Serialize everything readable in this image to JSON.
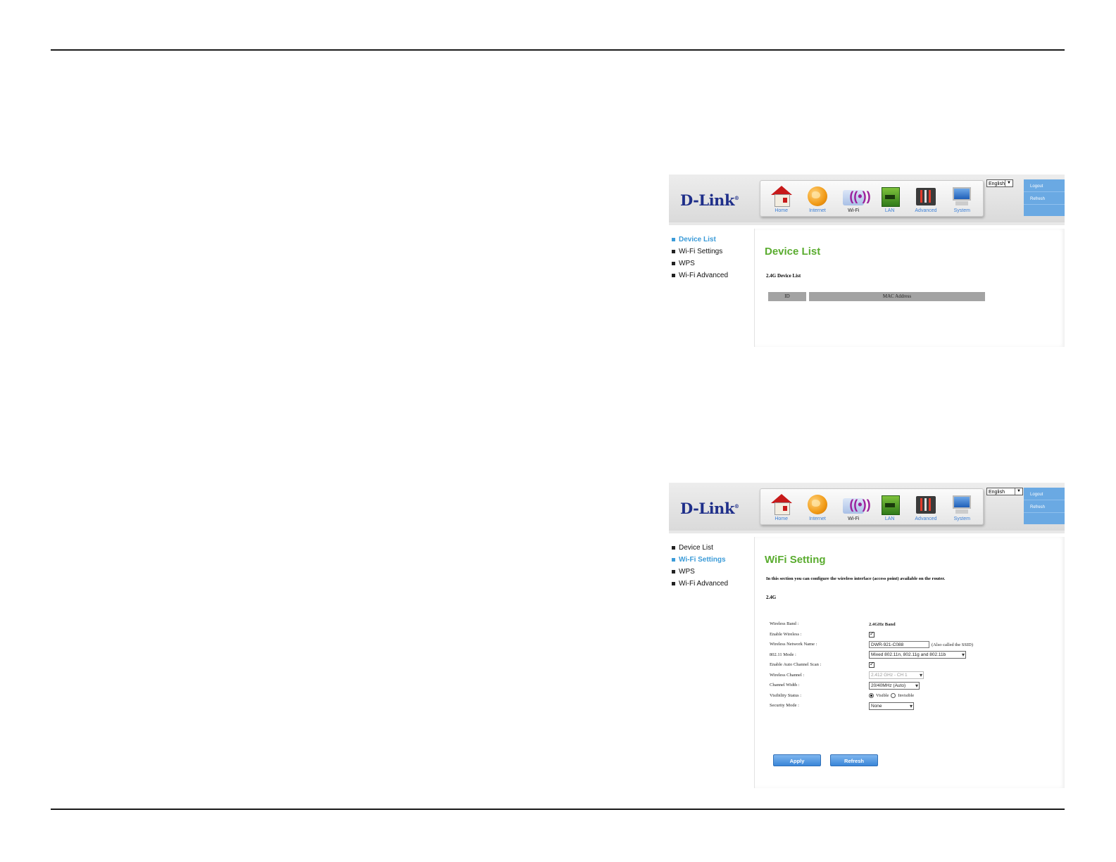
{
  "brand": "D-Link",
  "nav": {
    "items": [
      {
        "label": "Home",
        "icon": "home-icon"
      },
      {
        "label": "Internet",
        "icon": "globe-icon"
      },
      {
        "label": "Wi-Fi",
        "icon": "wifi-icon"
      },
      {
        "label": "LAN",
        "icon": "lan-icon"
      },
      {
        "label": "Advanced",
        "icon": "tools-icon"
      },
      {
        "label": "System",
        "icon": "monitor-icon"
      }
    ]
  },
  "language": "English",
  "side_buttons": {
    "logout": "Logout",
    "refresh": "Refresh"
  },
  "leftnav": [
    "Device List",
    "Wi-Fi Settings",
    "WPS",
    "Wi-Fi Advanced"
  ],
  "screen1": {
    "title": "Device List",
    "subheading": "2.4G Device List",
    "table_headers": [
      "ID",
      "MAC Address"
    ]
  },
  "screen2": {
    "title": "WiFi Setting",
    "description": "In this section you can configure the wireless interface (access point) available on the router.",
    "band_heading": "2.4G",
    "labels": {
      "band": "Wireless Band :",
      "enable": "Enable Wireless :",
      "ssid": "Wireless Network Name :",
      "mode": "802.11 Mode :",
      "autoscan": "Enable Auto Channel Scan :",
      "channel": "Wireless Channel :",
      "width": "Channel Width :",
      "visibility": "Visibility Status :",
      "security": "Security Mode :"
    },
    "values": {
      "band": "2.4GHz Band",
      "ssid": "DWR-921-C088",
      "ssid_note": "(Also called the SSID)",
      "mode": "Mixed 802.11n, 802.11g and 802.11b",
      "channel": "2.412 GHz - CH 1",
      "width": "20/40MHz (Auto)",
      "visible": "Visible",
      "invisible": "Invisible",
      "security": "None"
    },
    "buttons": {
      "apply": "Apply",
      "refresh": "Refresh"
    }
  }
}
